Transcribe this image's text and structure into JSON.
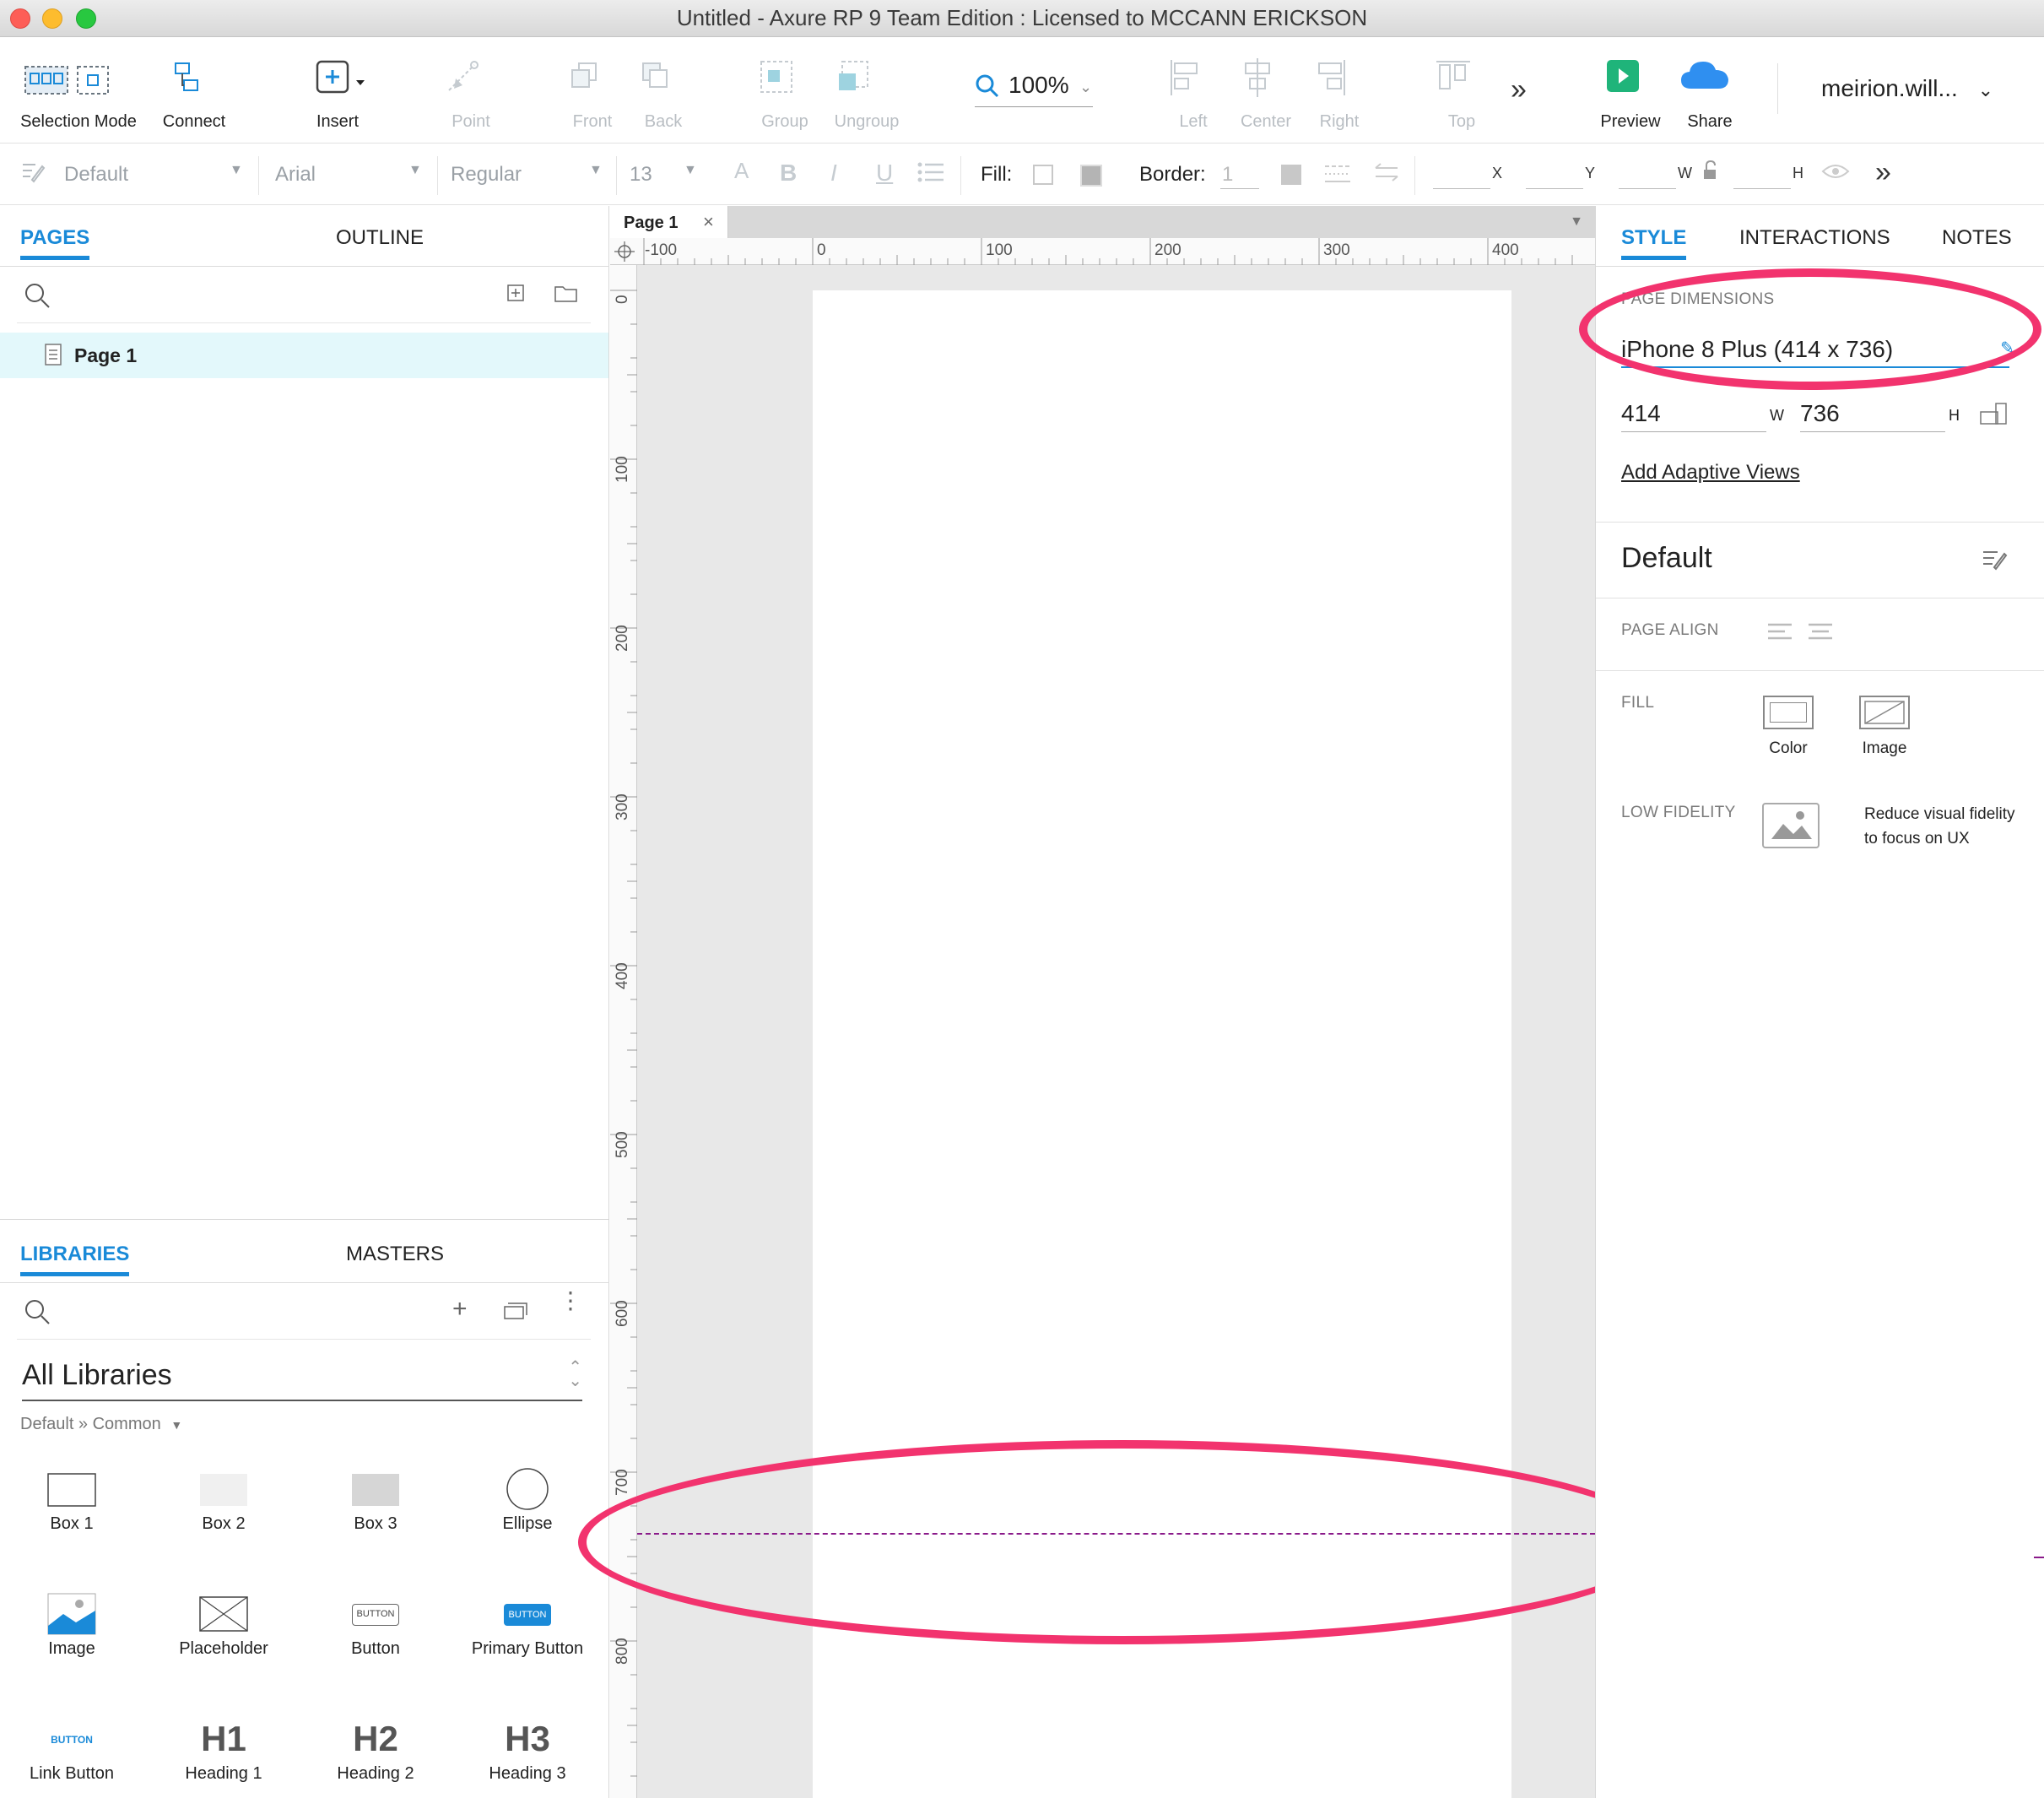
{
  "window": {
    "title": "Untitled - Axure RP 9 Team Edition : Licensed to MCCANN ERICKSON"
  },
  "toolbar": {
    "selection_mode": "Selection Mode",
    "connect": "Connect",
    "insert": "Insert",
    "point": "Point",
    "front": "Front",
    "back": "Back",
    "group": "Group",
    "ungroup": "Ungroup",
    "zoom": "100%",
    "left": "Left",
    "center": "Center",
    "right": "Right",
    "top": "Top",
    "preview": "Preview",
    "share": "Share",
    "user": "meirion.will..."
  },
  "formatbar": {
    "style": "Default",
    "font": "Arial",
    "weight": "Regular",
    "size": "13",
    "fill_label": "Fill:",
    "border_label": "Border:",
    "border_value": "1",
    "x": "X",
    "y": "Y",
    "w": "W",
    "h": "H"
  },
  "left": {
    "tabs": [
      "PAGES",
      "OUTLINE"
    ],
    "pages": [
      {
        "name": "Page 1"
      }
    ],
    "lib_tabs": [
      "LIBRARIES",
      "MASTERS"
    ],
    "library_select": "All Libraries",
    "breadcrumb": "Default » Common",
    "widgets": [
      "Box 1",
      "Box 2",
      "Box 3",
      "Ellipse",
      "Image",
      "Placeholder",
      "Button",
      "Primary Button",
      "Link Button",
      "Heading 1",
      "Heading 2",
      "Heading 3"
    ],
    "widget_glyphs": {
      "button": "BUTTON",
      "h1": "H1",
      "h2": "H2",
      "h3": "H3"
    }
  },
  "canvas": {
    "tab": "Page 1",
    "hruler": [
      "-100",
      "0",
      "100",
      "200",
      "300",
      "400"
    ],
    "vruler": [
      "0",
      "100",
      "200",
      "300",
      "400",
      "500",
      "600",
      "700",
      "800"
    ]
  },
  "right": {
    "tabs": [
      "STYLE",
      "INTERACTIONS",
      "NOTES"
    ],
    "page_dimensions_label": "PAGE DIMENSIONS",
    "device": "iPhone 8 Plus  (414 x 736)",
    "width": "414",
    "w_label": "W",
    "height": "736",
    "h_label": "H",
    "add_adaptive": "Add Adaptive Views",
    "style_name": "Default",
    "page_align": "PAGE ALIGN",
    "fill": "FILL",
    "fill_color": "Color",
    "fill_image": "Image",
    "low_fidelity": "LOW FIDELITY",
    "low_fidelity_desc_1": "Reduce visual fidelity",
    "low_fidelity_desc_2": "to focus on UX"
  },
  "colors": {
    "accent": "#1a8ad8",
    "annotation": "#f2336e",
    "guide": "#8a1a8a",
    "preview": "#1fb47a"
  }
}
